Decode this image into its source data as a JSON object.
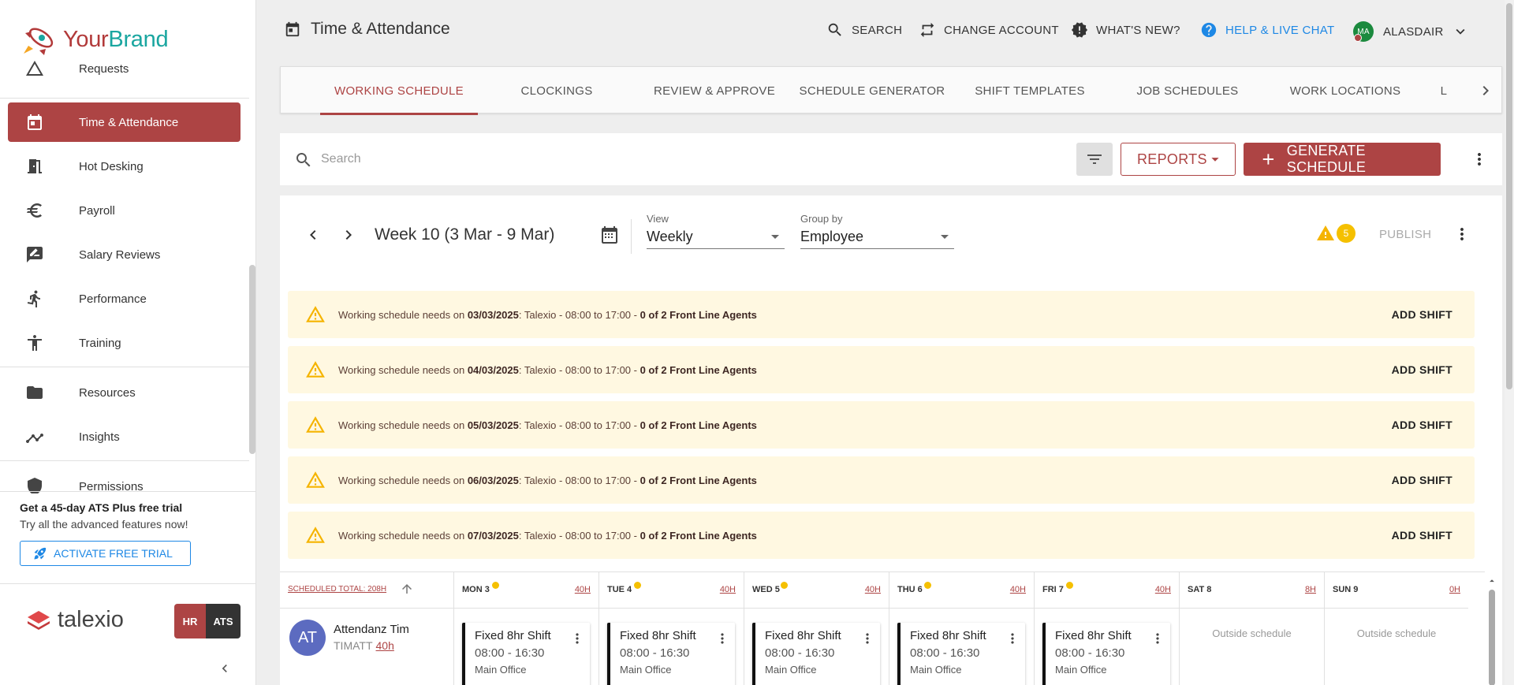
{
  "brand": {
    "your": "Your",
    "name": "Brand"
  },
  "sidebar": {
    "items": [
      {
        "label": "Requests",
        "icon": "warning-outline-icon"
      },
      {
        "label": "Time & Attendance",
        "icon": "calendar-icon",
        "active": true
      },
      {
        "label": "Hot Desking",
        "icon": "door-icon"
      },
      {
        "label": "Payroll",
        "icon": "euro-icon"
      },
      {
        "label": "Salary Reviews",
        "icon": "rate-review-icon"
      },
      {
        "label": "Performance",
        "icon": "run-icon"
      },
      {
        "label": "Training",
        "icon": "accessibility-icon"
      },
      {
        "label": "Resources",
        "icon": "folder-icon"
      },
      {
        "label": "Insights",
        "icon": "insights-icon"
      },
      {
        "label": "Permissions",
        "icon": "shield-icon"
      }
    ]
  },
  "promo": {
    "title": "Get a 45-day ATS Plus free trial",
    "subtitle": "Try all the advanced features now!",
    "button": "ACTIVATE FREE TRIAL"
  },
  "footer": {
    "logo_text": "talexio",
    "hr": "HR",
    "ats": "ATS"
  },
  "header": {
    "title": "Time & Attendance",
    "search": "SEARCH",
    "change_account": "CHANGE ACCOUNT",
    "whats_new": "WHAT'S NEW?",
    "help": "HELP & LIVE CHAT",
    "user_initials": "MA",
    "user_name": "ALASDAIR"
  },
  "tabs": [
    {
      "label": "WORKING SCHEDULE",
      "active": true
    },
    {
      "label": "CLOCKINGS"
    },
    {
      "label": "REVIEW & APPROVE"
    },
    {
      "label": "SCHEDULE GENERATOR"
    },
    {
      "label": "SHIFT TEMPLATES"
    },
    {
      "label": "JOB SCHEDULES"
    },
    {
      "label": "WORK LOCATIONS"
    },
    {
      "label": "L"
    }
  ],
  "toolbar": {
    "search_placeholder": "Search",
    "reports": "REPORTS",
    "generate": "GENERATE SCHEDULE"
  },
  "schedule": {
    "week_label": "Week 10 (3 Mar - 9 Mar)",
    "view_label": "View",
    "view_value": "Weekly",
    "group_label": "Group by",
    "group_value": "Employee",
    "warning_count": "5",
    "publish": "PUBLISH"
  },
  "alerts": [
    {
      "prefix": "Working schedule needs on ",
      "date": "03/03/2025",
      "middle": ": Talexio - 08:00 to 17:00 - ",
      "need": "0 of 2 Front Line Agents",
      "action": "ADD SHIFT"
    },
    {
      "prefix": "Working schedule needs on ",
      "date": "04/03/2025",
      "middle": ": Talexio - 08:00 to 17:00 - ",
      "need": "0 of 2 Front Line Agents",
      "action": "ADD SHIFT"
    },
    {
      "prefix": "Working schedule needs on ",
      "date": "05/03/2025",
      "middle": ": Talexio - 08:00 to 17:00 - ",
      "need": "0 of 2 Front Line Agents",
      "action": "ADD SHIFT"
    },
    {
      "prefix": "Working schedule needs on ",
      "date": "06/03/2025",
      "middle": ": Talexio - 08:00 to 17:00 - ",
      "need": "0 of 2 Front Line Agents",
      "action": "ADD SHIFT"
    },
    {
      "prefix": "Working schedule needs on ",
      "date": "07/03/2025",
      "middle": ": Talexio - 08:00 to 17:00 - ",
      "need": "0 of 2 Front Line Agents",
      "action": "ADD SHIFT"
    }
  ],
  "grid": {
    "scheduled_total": "SCHEDULED TOTAL: 208H",
    "days": [
      {
        "label": "MON 3",
        "hours": "40H",
        "warn": true
      },
      {
        "label": "TUE 4",
        "hours": "40H",
        "warn": true
      },
      {
        "label": "WED 5",
        "hours": "40H",
        "warn": true
      },
      {
        "label": "THU 6",
        "hours": "40H",
        "warn": true
      },
      {
        "label": "FRI 7",
        "hours": "40H",
        "warn": true
      },
      {
        "label": "SAT 8",
        "hours": "8H",
        "warn": false
      },
      {
        "label": "SUN 9",
        "hours": "0H",
        "warn": false
      }
    ],
    "employee": {
      "initials": "AT",
      "name": "Attendanz Tim",
      "code": "TIMATT",
      "hours": "40h"
    },
    "shift": {
      "title": "Fixed 8hr Shift",
      "time": "08:00 - 16:30",
      "location": "Main Office"
    },
    "outside": "Outside schedule"
  }
}
